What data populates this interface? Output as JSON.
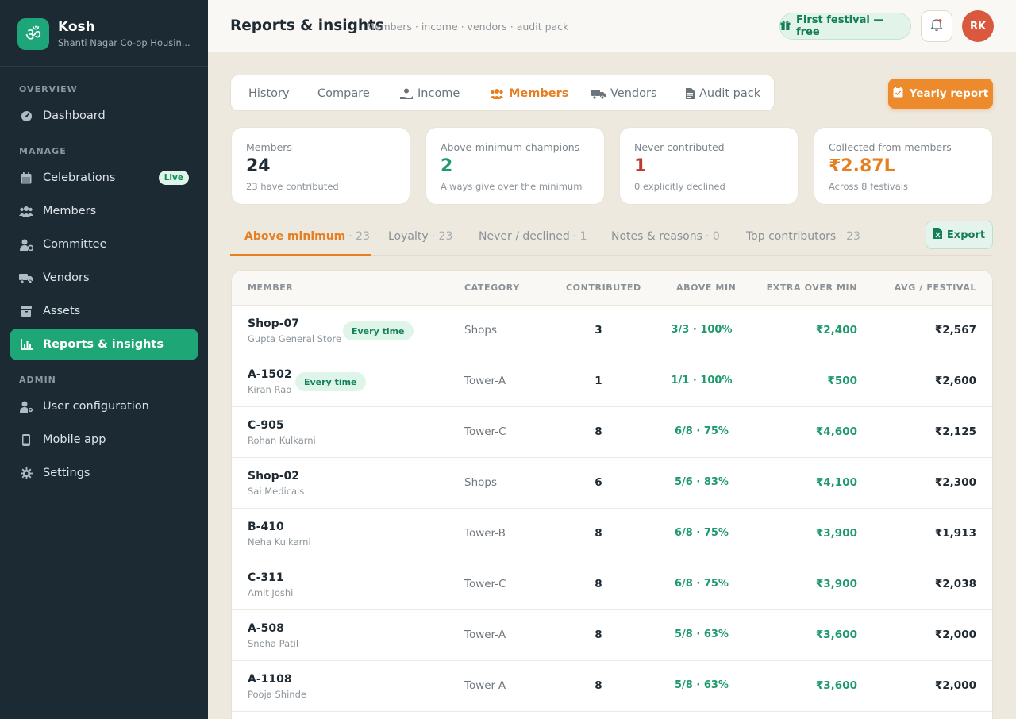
{
  "brand": {
    "name": "Kosh",
    "subtitle": "Shanti Nagar Co-op Housin...",
    "logo_glyph": "ॐ"
  },
  "sidebar": {
    "sections": {
      "overview": "OVERVIEW",
      "manage": "MANAGE",
      "admin": "ADMIN"
    },
    "items": [
      {
        "label": "Dashboard",
        "icon": "dashboard-icon"
      },
      {
        "label": "Celebrations",
        "icon": "calendar-icon",
        "badge": "Live"
      },
      {
        "label": "Members",
        "icon": "users-icon"
      },
      {
        "label": "Committee",
        "icon": "user-gear-icon"
      },
      {
        "label": "Vendors",
        "icon": "truck-icon"
      },
      {
        "label": "Assets",
        "icon": "archive-icon"
      },
      {
        "label": "Reports & insights",
        "icon": "chart-icon",
        "active": true
      },
      {
        "label": "User configuration",
        "icon": "user-cog-icon"
      },
      {
        "label": "Mobile app",
        "icon": "phone-icon"
      },
      {
        "label": "Settings",
        "icon": "gear-icon"
      }
    ]
  },
  "header": {
    "title": "Reports & insights",
    "subtitle": "Members · income · vendors · audit pack",
    "festival_button": "First festival — free",
    "avatar_initials": "RK"
  },
  "report_tabs": [
    {
      "label": "History",
      "icon": ""
    },
    {
      "label": "Compare",
      "icon": ""
    },
    {
      "label": "Income",
      "icon": "hand-coin-icon"
    },
    {
      "label": "Members",
      "icon": "users-icon",
      "active": true
    },
    {
      "label": "Vendors",
      "icon": "truck-icon"
    },
    {
      "label": "Audit pack",
      "icon": "file-icon"
    }
  ],
  "yearly_report_button": "Yearly report",
  "stats": [
    {
      "label": "Members",
      "value": "24",
      "sub": "23 have contributed",
      "color": "#1f2a33"
    },
    {
      "label": "Above-minimum champions",
      "value": "2",
      "sub": "Always give over the minimum",
      "color": "#1f9a6c"
    },
    {
      "label": "Never contributed",
      "value": "1",
      "sub": "0 explicitly declined",
      "color": "#c0392b"
    },
    {
      "label": "Collected from members",
      "value": "₹2.87L",
      "sub": "Across 8 festivals",
      "color": "#e67e22"
    }
  ],
  "sub_tabs": [
    {
      "label": "Above minimum",
      "count": "· 23",
      "active": true
    },
    {
      "label": "Loyalty",
      "count": "· 23"
    },
    {
      "label": "Never / declined",
      "count": "· 1"
    },
    {
      "label": "Notes & reasons",
      "count": "· 0"
    },
    {
      "label": "Top contributors",
      "count": "· 23"
    }
  ],
  "export_button": "Export",
  "table": {
    "columns": [
      "MEMBER",
      "CATEGORY",
      "CONTRIBUTED",
      "ABOVE MIN",
      "EXTRA OVER MIN",
      "AVG / FESTIVAL"
    ],
    "rows": [
      {
        "code": "Shop-07",
        "name": "Gupta General Store",
        "badge": "Every time",
        "category": "Shops",
        "contributed": "3",
        "above_min": "3/3 · 100%",
        "extra": "₹2,400",
        "avg": "₹2,567"
      },
      {
        "code": "A-1502",
        "name": "Kiran Rao",
        "badge": "Every time",
        "category": "Tower-A",
        "contributed": "1",
        "above_min": "1/1 · 100%",
        "extra": "₹500",
        "avg": "₹2,600"
      },
      {
        "code": "C-905",
        "name": "Rohan Kulkarni",
        "badge": "",
        "category": "Tower-C",
        "contributed": "8",
        "above_min": "6/8 · 75%",
        "extra": "₹4,600",
        "avg": "₹2,125"
      },
      {
        "code": "Shop-02",
        "name": "Sai Medicals",
        "badge": "",
        "category": "Shops",
        "contributed": "6",
        "above_min": "5/6 · 83%",
        "extra": "₹4,100",
        "avg": "₹2,300"
      },
      {
        "code": "B-410",
        "name": "Neha Kulkarni",
        "badge": "",
        "category": "Tower-B",
        "contributed": "8",
        "above_min": "6/8 · 75%",
        "extra": "₹3,900",
        "avg": "₹1,913"
      },
      {
        "code": "C-311",
        "name": "Amit Joshi",
        "badge": "",
        "category": "Tower-C",
        "contributed": "8",
        "above_min": "6/8 · 75%",
        "extra": "₹3,900",
        "avg": "₹2,038"
      },
      {
        "code": "A-508",
        "name": "Sneha Patil",
        "badge": "",
        "category": "Tower-A",
        "contributed": "8",
        "above_min": "5/8 · 63%",
        "extra": "₹3,600",
        "avg": "₹2,000"
      },
      {
        "code": "A-1108",
        "name": "Pooja Shinde",
        "badge": "",
        "category": "Tower-A",
        "contributed": "8",
        "above_min": "5/8 · 63%",
        "extra": "₹3,600",
        "avg": "₹2,000"
      }
    ]
  }
}
